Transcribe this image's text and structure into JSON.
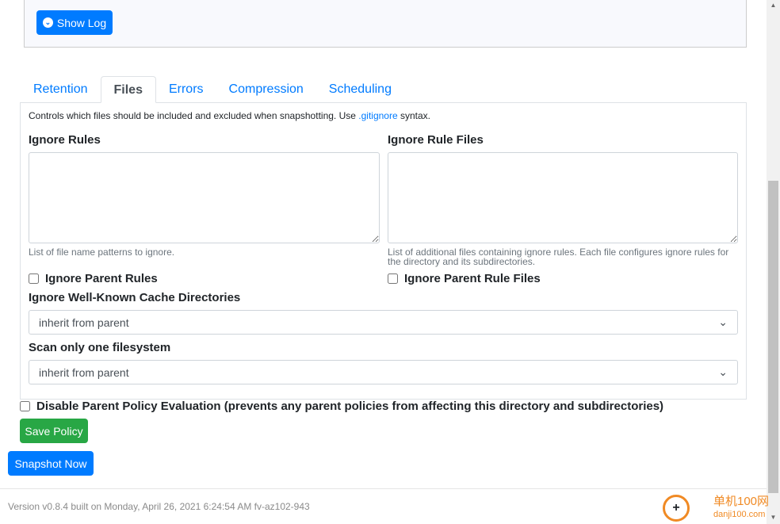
{
  "log": {
    "show_log_label": "Show Log"
  },
  "tabs": [
    {
      "label": "Retention"
    },
    {
      "label": "Files",
      "active": true
    },
    {
      "label": "Errors"
    },
    {
      "label": "Compression"
    },
    {
      "label": "Scheduling"
    }
  ],
  "files": {
    "description_before": "Controls which files should be included and excluded when snapshotting. Use ",
    "description_link": ".gitignore",
    "description_after": " syntax.",
    "ignore_rules_label": "Ignore Rules",
    "ignore_rules_value": "",
    "ignore_rules_help": "List of file name patterns to ignore.",
    "ignore_rule_files_label": "Ignore Rule Files",
    "ignore_rule_files_value": "",
    "ignore_rule_files_help": "List of additional files containing ignore rules. Each file configures ignore rules for the directory and its subdirectories.",
    "ignore_parent_rules_label": "Ignore Parent Rules",
    "ignore_parent_rule_files_label": "Ignore Parent Rule Files",
    "cache_dirs_label": "Ignore Well-Known Cache Directories",
    "cache_dirs_value": "inherit from parent",
    "one_fs_label": "Scan only one filesystem",
    "one_fs_value": "inherit from parent"
  },
  "disable_parent_label": "Disable Parent Policy Evaluation (prevents any parent policies from affecting this directory and subdirectories)",
  "save_label": "Save Policy",
  "snapshot_label": "Snapshot Now",
  "footer": {
    "version": "Version v0.8.4 built on Monday, April 26, 2021 6:24:54 AM fv-az102-943"
  },
  "watermark": {
    "text": "单机100网",
    "url": "danji100.com"
  },
  "colors": {
    "primary": "#007bff",
    "success": "#28a745"
  }
}
